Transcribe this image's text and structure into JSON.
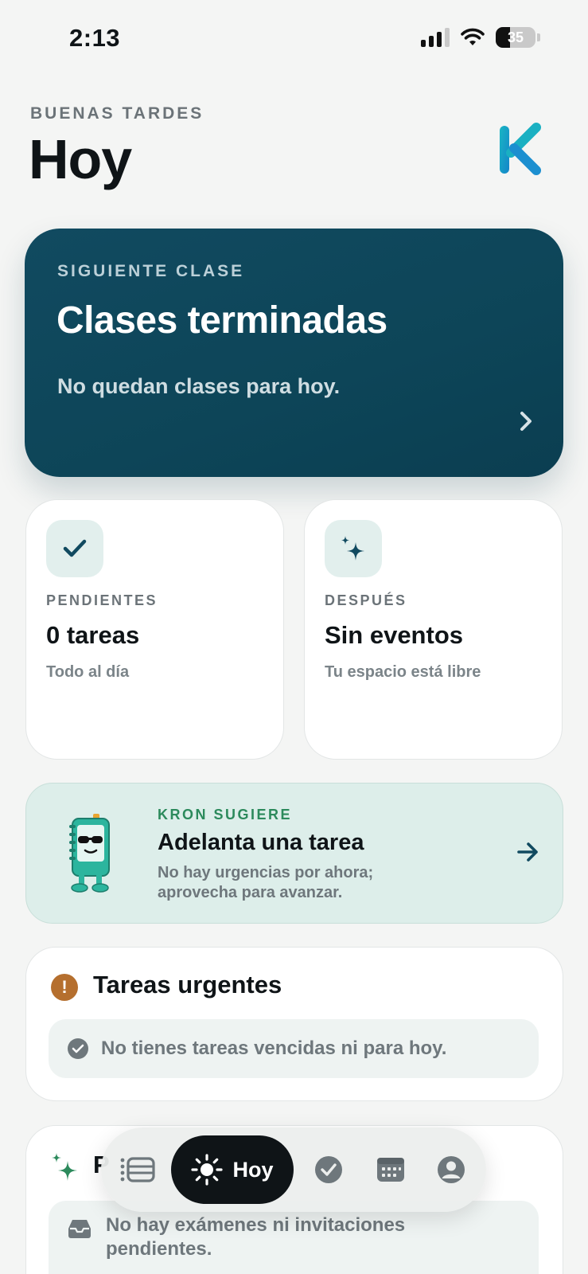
{
  "status_bar": {
    "time": "2:13",
    "battery_level": "35",
    "battery_fraction": 0.35
  },
  "header": {
    "greeting": "BUENAS TARDES",
    "title": "Hoy",
    "brand_color": "#1ca8b8"
  },
  "next_class": {
    "kicker": "SIGUIENTE CLASE",
    "title": "Clases terminadas",
    "subtitle": "No quedan clases para hoy.",
    "background": "#0d4558"
  },
  "pending_card": {
    "icon": "check-icon",
    "kicker": "PENDIENTES",
    "value": "0 tareas",
    "note": "Todo al día"
  },
  "after_card": {
    "icon": "sparkle-icon",
    "kicker": "DESPUÉS",
    "value": "Sin eventos",
    "note": "Tu espacio está libre"
  },
  "suggestion": {
    "kicker": "KRON SUGIERE",
    "title": "Adelanta una tarea",
    "description": "No hay urgencias por ahora; aprovecha para avanzar.",
    "accent": "#2c8a5c"
  },
  "urgent_tasks": {
    "icon": "warning-icon",
    "title": "Tareas urgentes",
    "empty_message": "No tienes tareas vencidas ni para hoy."
  },
  "exams": {
    "icon": "sparkle-icon",
    "title_visible": "P",
    "empty_message": "No hay exámenes ni invitaciones pendientes."
  },
  "tab_bar": {
    "active_label": "Hoy",
    "tabs": [
      "schedule-icon",
      "sun-icon",
      "check-circle-icon",
      "calendar-icon",
      "profile-icon"
    ]
  }
}
